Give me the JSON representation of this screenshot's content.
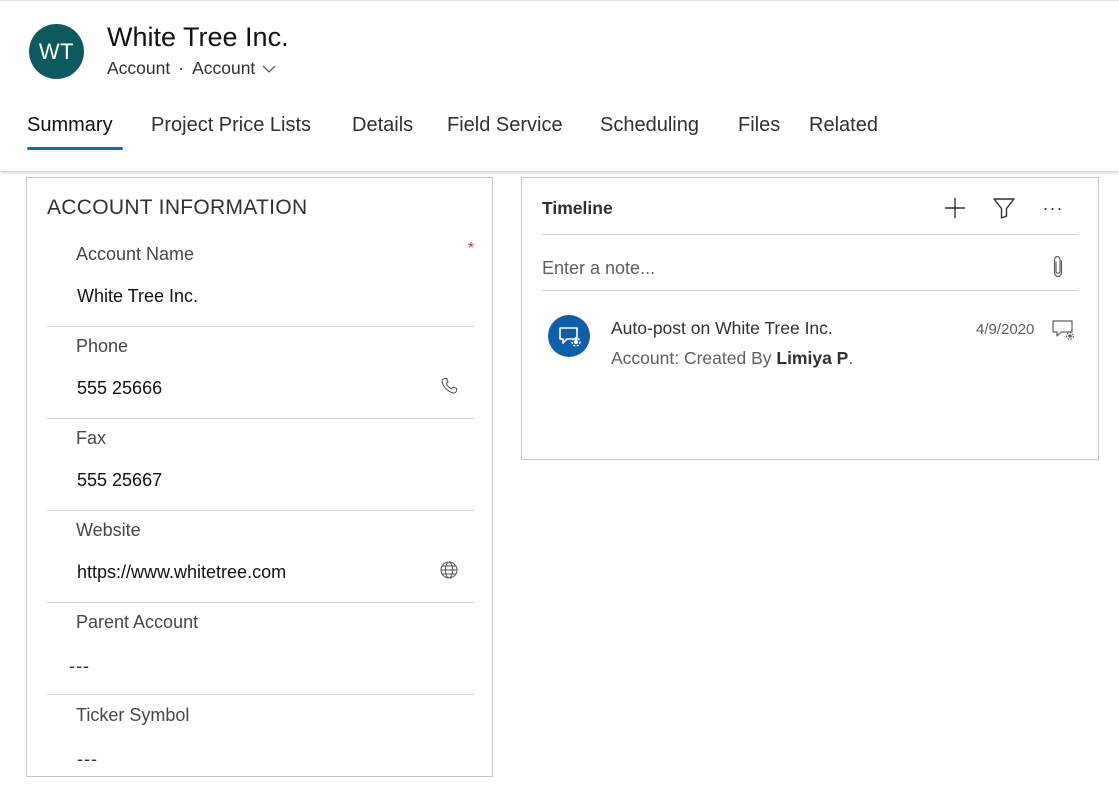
{
  "header": {
    "avatar_initials": "WT",
    "title": "White Tree Inc.",
    "entity": "Account",
    "separator": "·",
    "form_name": "Account",
    "avatar_color": "#0c5a5f",
    "accent_color": "#0f6cbd"
  },
  "tabs": [
    {
      "label": "Summary",
      "active": true
    },
    {
      "label": "Project Price Lists"
    },
    {
      "label": "Details"
    },
    {
      "label": "Field Service"
    },
    {
      "label": "Scheduling"
    },
    {
      "label": "Files"
    },
    {
      "label": "Related"
    }
  ],
  "account_info": {
    "title": "ACCOUNT INFORMATION",
    "fields": [
      {
        "label": "Account Name",
        "value": "White Tree Inc.",
        "required_mark": "*"
      },
      {
        "label": "Phone",
        "value": "555 25666",
        "icon": "phone-icon"
      },
      {
        "label": "Fax",
        "value": "555 25667"
      },
      {
        "label": "Website",
        "value": "https://www.whitetree.com",
        "icon": "globe-icon"
      },
      {
        "label": "Parent Account",
        "value": "---"
      },
      {
        "label": "Ticker Symbol",
        "value": "---"
      }
    ]
  },
  "timeline": {
    "title": "Timeline",
    "add_icon": "plus-icon",
    "filter_icon": "filter-icon",
    "more_icon": "more-icon",
    "more_label": "···",
    "note_placeholder": "Enter a note...",
    "attach_icon": "paperclip-icon",
    "posts": [
      {
        "title": "Auto-post on White Tree Inc.",
        "subtitle_prefix": "Account: Created By ",
        "author": "Limiya P",
        "subtitle_suffix": ".",
        "date": "4/9/2020",
        "icon": "auto-post-icon",
        "avatar_color": "#0f5ea8"
      }
    ]
  }
}
